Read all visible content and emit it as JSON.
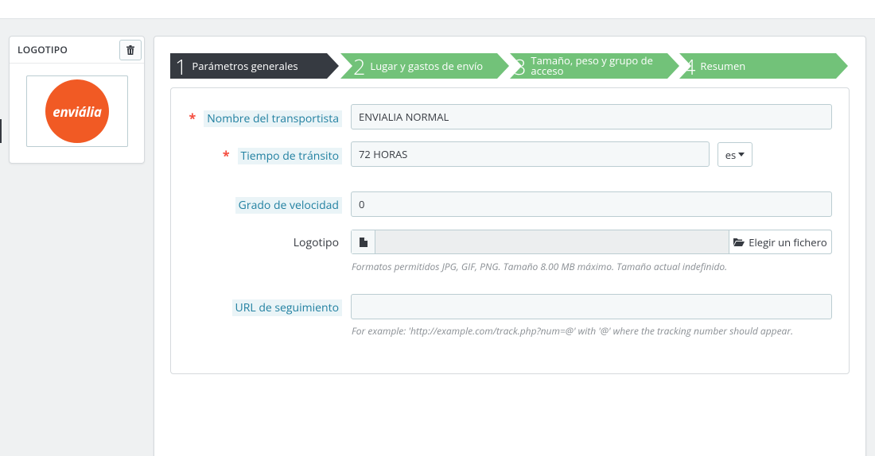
{
  "logo_panel": {
    "title": "LOGOTIPO",
    "logo_text": "enviália"
  },
  "wizard": {
    "steps": [
      {
        "num": "1",
        "label": "Parámetros generales",
        "state": "active"
      },
      {
        "num": "2",
        "label": "Lugar y gastos de envío",
        "state": "done"
      },
      {
        "num": "3",
        "label": "Tamaño, peso y grupo de acceso",
        "state": "done"
      },
      {
        "num": "4",
        "label": "Resumen",
        "state": "done"
      }
    ]
  },
  "form": {
    "carrier_name": {
      "label": "Nombre del transportista",
      "value": "ENVIALIA NORMAL",
      "required": true
    },
    "transit_time": {
      "label": "Tiempo de tránsito",
      "value": "72 HORAS",
      "required": true,
      "language": "es"
    },
    "speed_grade": {
      "label": "Grado de velocidad",
      "value": "0"
    },
    "logo": {
      "label": "Logotipo",
      "button_label": "Elegir un fichero",
      "help": "Formatos permitidos JPG, GIF, PNG. Tamaño 8.00 MB máximo. Tamaño actual indefinido."
    },
    "tracking_url": {
      "label": "URL de seguimiento",
      "value": "",
      "help": "For example: 'http://example.com/track.php?num=@' with '@' where the tracking number should appear."
    }
  },
  "colors": {
    "active_step": "#363a41",
    "done_step": "#72c279",
    "required_star": "#f54c3e",
    "brand_logo": "#f15a24"
  }
}
